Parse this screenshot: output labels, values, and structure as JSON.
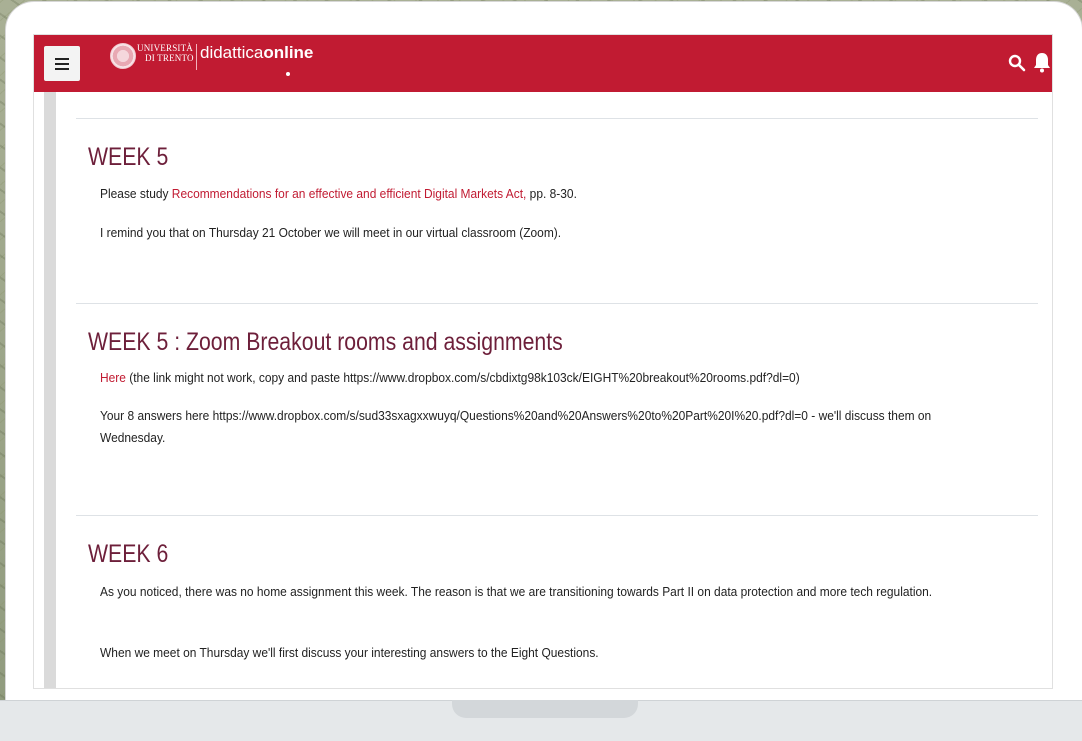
{
  "header": {
    "menu_icon": "hamburger-icon",
    "logo_university_line1": "UNIVERSITÀ",
    "logo_university_line2": "DI TRENTO",
    "logo_brand_regular": "didattica",
    "logo_brand_bold": "online",
    "icons": [
      "search-icon",
      "bell-icon"
    ],
    "bar_color": "#c11b32"
  },
  "sections": [
    {
      "title": "WEEK 5",
      "p1_prefix": "Please study ",
      "p1_link": "Recommendations for an effective and efficient Digital Markets Act,",
      "p1_suffix": " pp. 8-30.",
      "p2": "I remind you that on Thursday 21 October we will meet in our virtual classroom (Zoom)."
    },
    {
      "title": "WEEK 5 : Zoom Breakout rooms and assignments",
      "p1_link": "Here",
      "p1_suffix": " (the link might not work, copy and paste  https://www.dropbox.com/s/cbdixtg98k103ck/EIGHT%20breakout%20rooms.pdf?dl=0)",
      "p2": "Your 8 answers here https://www.dropbox.com/s/sud33sxagxxwuyq/Questions%20and%20Answers%20to%20Part%20I%20.pdf?dl=0 - we'll discuss them on Wednesday."
    },
    {
      "title": "WEEK 6",
      "p1": "As you noticed, there was no home assignment this week. The reason is that we are transitioning towards Part II on data protection and more tech regulation.",
      "p2": "When we meet on Thursday we'll first discuss your interesting answers to the Eight Questions."
    }
  ],
  "theme": {
    "heading_color": "#6d1f3a",
    "link_color": "#c11b32"
  }
}
